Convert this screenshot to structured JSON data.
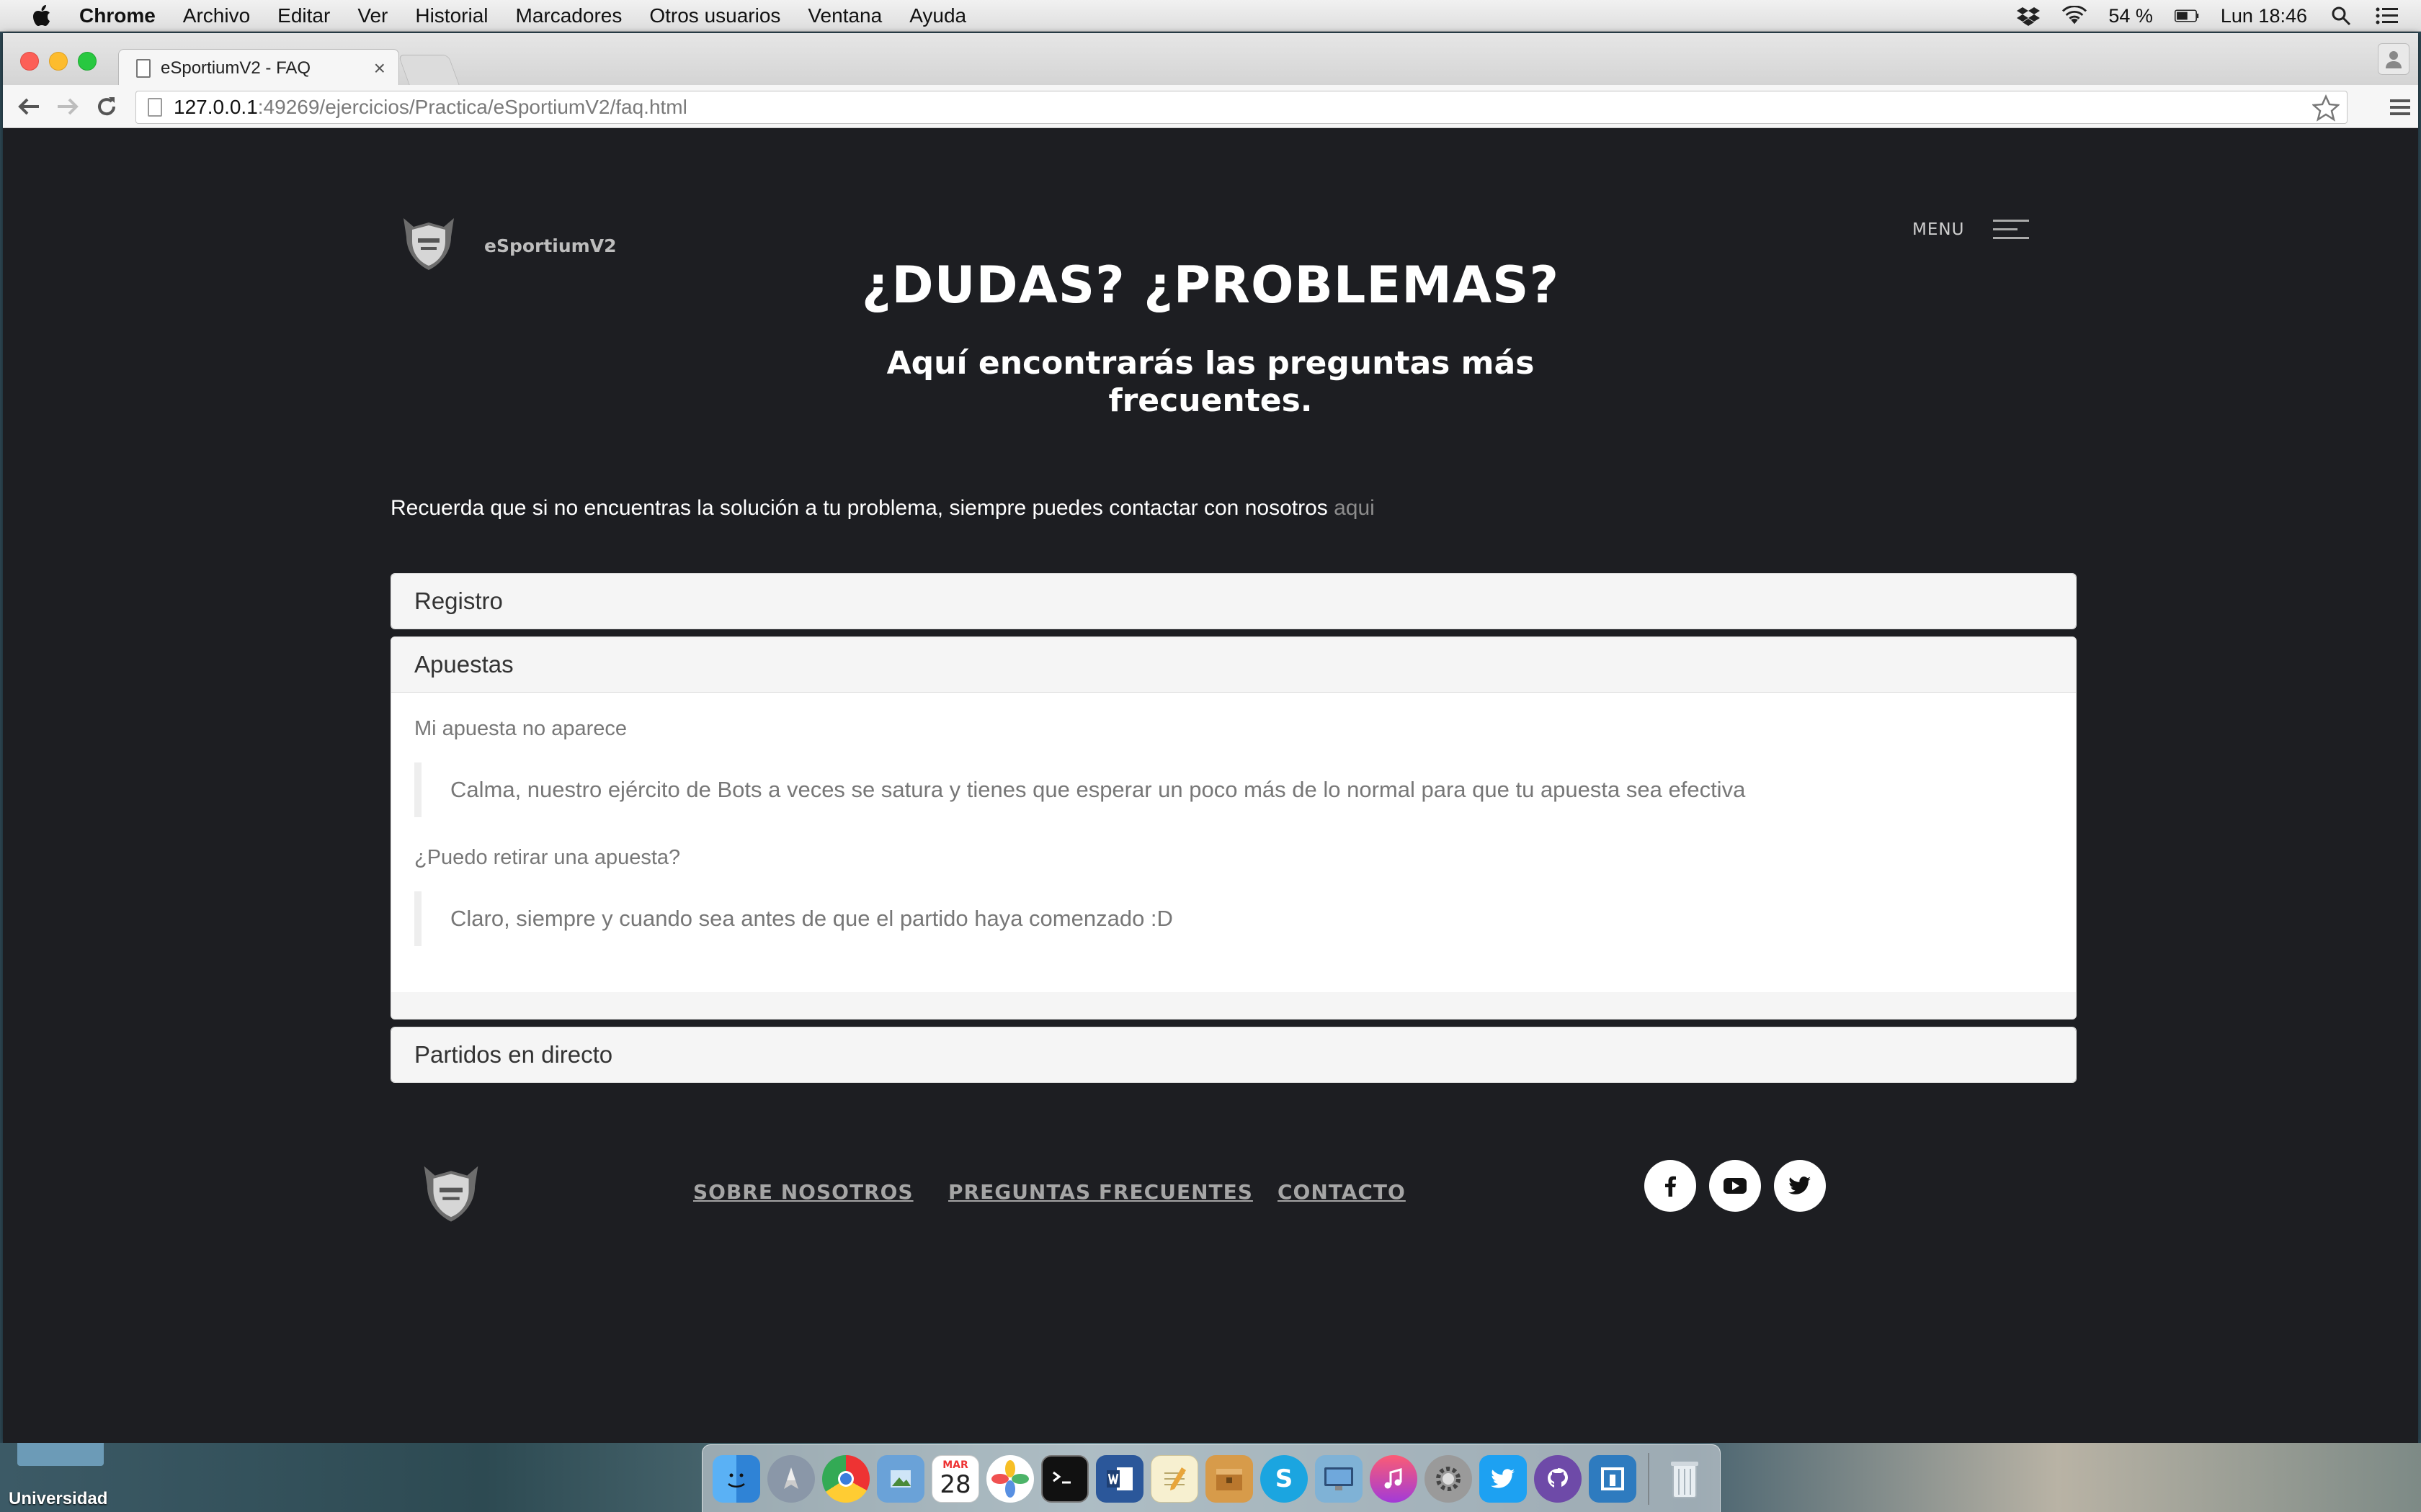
{
  "menubar": {
    "app": "Chrome",
    "items": [
      "Archivo",
      "Editar",
      "Ver",
      "Historial",
      "Marcadores",
      "Otros usuarios",
      "Ventana",
      "Ayuda"
    ],
    "battery": "54 %",
    "clock": "Lun 18:46"
  },
  "browser": {
    "tab_title": "eSportiumV2 - FAQ",
    "tab_close": "×",
    "url_host": "127.0.0.1",
    "url_rest": ":49269/ejercicios/Practica/eSportiumV2/faq.html"
  },
  "site": {
    "brand": "eSportiumV2",
    "menu_label": "MENU",
    "hero_title": "¿DUDAS? ¿PROBLEMAS?",
    "hero_subtitle": "Aquí encontrarás las preguntas más frecuentes.",
    "intro_text": "Recuerda que si no encuentras la solución a tu problema, siempre puedes contactar con nosotros ",
    "intro_link": "aqui"
  },
  "faq": {
    "sections": [
      {
        "title": "Registro"
      },
      {
        "title": "Apuestas",
        "items": [
          {
            "question": "Mi apuesta no aparece",
            "answer": "Calma, nuestro ejército de Bots a veces se satura y tienes que esperar un poco más de lo normal para que tu apuesta sea efectiva"
          },
          {
            "question": "¿Puedo retirar una apuesta?",
            "answer": "Claro, siempre y cuando sea antes de que el partido haya comenzado :D"
          }
        ]
      },
      {
        "title": "Partidos en directo"
      }
    ]
  },
  "footer": {
    "links": [
      "SOBRE NOSOTROS",
      "PREGUNTAS FRECUENTES",
      "CONTACTO"
    ],
    "social": [
      "facebook-icon",
      "youtube-icon",
      "twitter-icon"
    ]
  },
  "desktop": {
    "folder_label": "Universidad",
    "calendar_day": "28",
    "calendar_month": "MAR"
  }
}
